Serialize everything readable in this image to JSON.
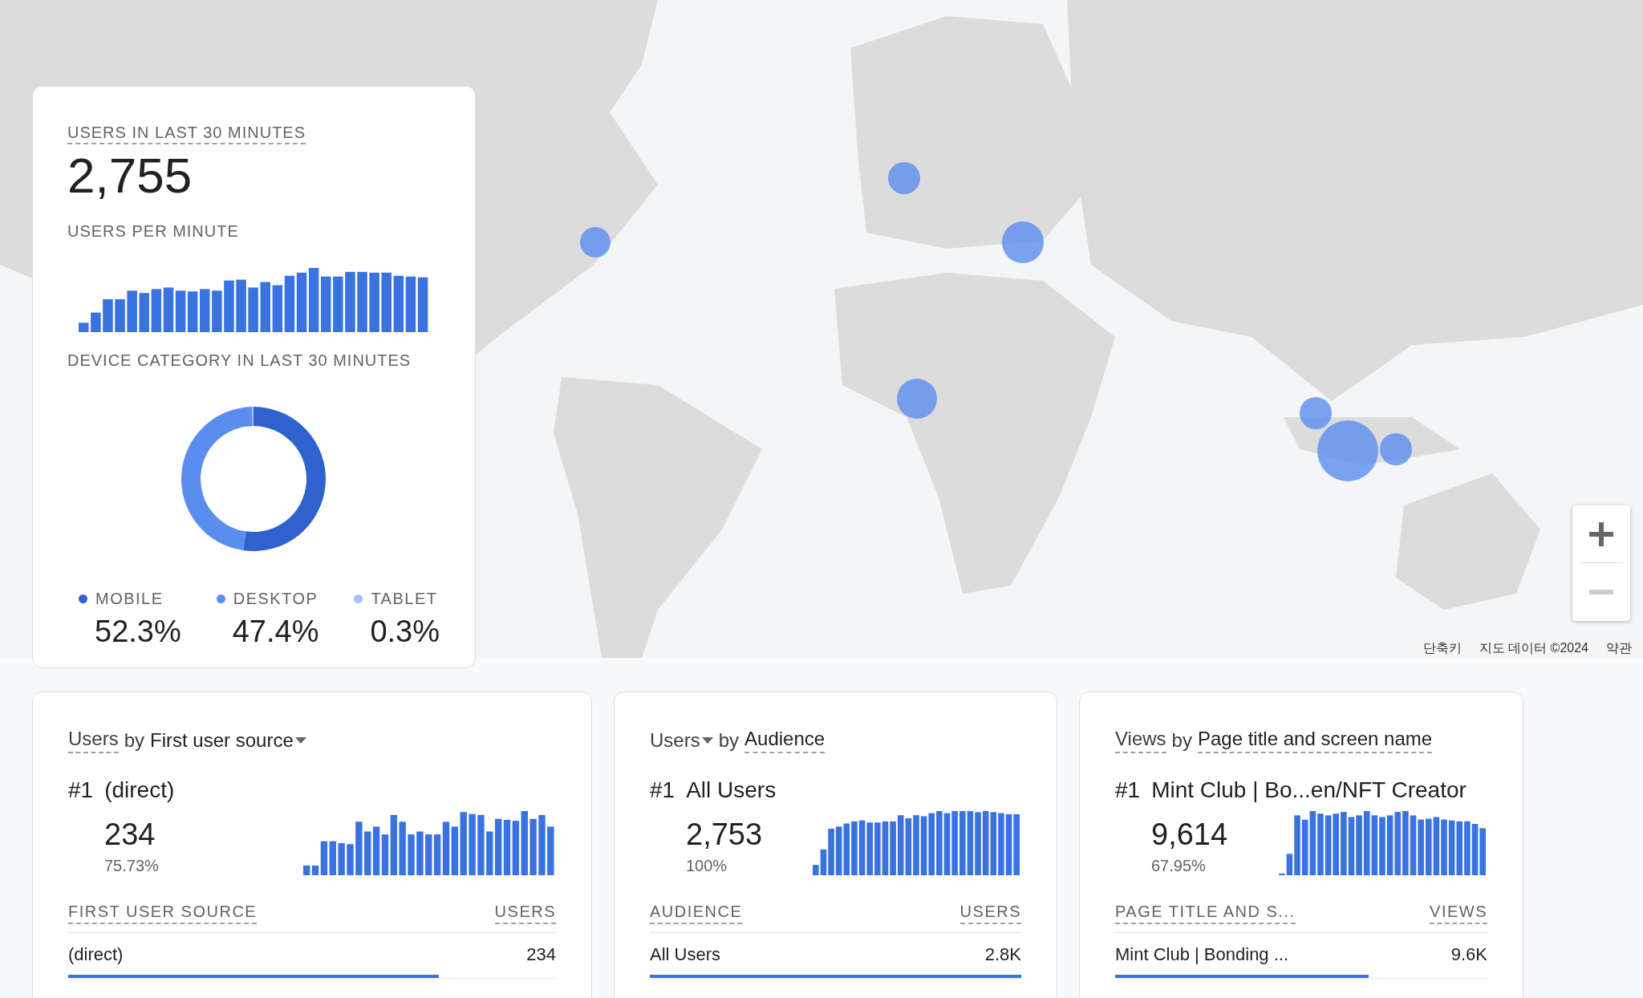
{
  "map": {
    "zoom_out_disabled": true,
    "attribution": [
      "단축키",
      "지도 데이터 ©2024",
      "약관"
    ]
  },
  "realtime_card": {
    "title": "USERS IN LAST 30 MINUTES",
    "value": "2,755",
    "per_minute_label": "USERS PER MINUTE",
    "device_label": "DEVICE CATEGORY IN LAST 30 MINUTES",
    "chart_data": {
      "type": "donut",
      "categories": [
        "MOBILE",
        "DESKTOP",
        "TABLET"
      ],
      "values": [
        52.3,
        47.4,
        0.3
      ]
    },
    "legend": [
      {
        "value": "52.3%",
        "color": "#2f62cf"
      },
      {
        "value": "47.4%",
        "color": "#5b8def"
      },
      {
        "value": "0.3%",
        "color": "#a4c2f4"
      }
    ]
  },
  "cards": [
    {
      "metric": "Users",
      "metric_dropdown": false,
      "connector": "by",
      "dimension": "First user source",
      "dimension_dropdown": true,
      "rank": "#1",
      "top_name": "(direct)",
      "top_value": "234",
      "top_share": "75.73%",
      "columns": [
        "FIRST USER SOURCE",
        "USERS"
      ],
      "row": {
        "name": "(direct)",
        "value": "234",
        "level": 0.76
      }
    },
    {
      "metric": "Users",
      "metric_dropdown": true,
      "connector": "by",
      "dimension": "Audience",
      "dimension_dropdown": false,
      "rank": "#1",
      "top_name": "All Users",
      "top_value": "2,753",
      "top_share": "100%",
      "columns": [
        "AUDIENCE",
        "USERS"
      ],
      "row": {
        "name": "All Users",
        "value": "2.8K",
        "level": 1
      }
    },
    {
      "metric": "Views",
      "metric_dropdown": false,
      "connector": "by",
      "dimension": "Page title and screen name",
      "dimension_dropdown": false,
      "rank": "#1",
      "top_name": "Mint Club | Bo...en/NFT Creator",
      "top_value": "9,614",
      "top_share": "67.95%",
      "columns": [
        "PAGE TITLE AND S...",
        "VIEWS"
      ],
      "row": {
        "name": "Mint Club | Bonding ...",
        "value": "9.6K",
        "level": 0.68
      }
    }
  ]
}
